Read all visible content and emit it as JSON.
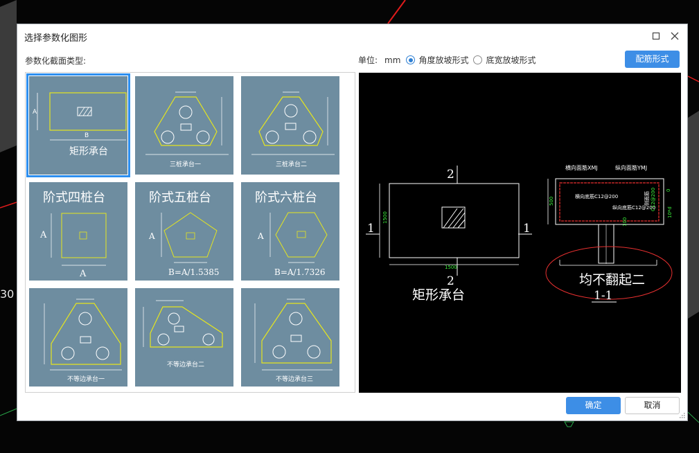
{
  "background": {
    "side_number": "30"
  },
  "window": {
    "title": "选择参数化图形",
    "maximize_icon": "square-icon",
    "close_icon": "close-icon"
  },
  "gallery": {
    "label": "参数化截面类型:",
    "items": [
      {
        "name": "矩形承台",
        "selected": true
      },
      {
        "name": "三桩承台一"
      },
      {
        "name": "三桩承台二"
      },
      {
        "name": "阶式四桩台",
        "formula": "A"
      },
      {
        "name": "阶式五桩台",
        "formula": "B=A/1.5385"
      },
      {
        "name": "阶式六桩台",
        "formula": "B=A/1.7326"
      },
      {
        "name": "不等边承台一"
      },
      {
        "name": "不等边承台二"
      },
      {
        "name": "不等边承台三"
      }
    ]
  },
  "options": {
    "unit_label": "单位:",
    "unit_value": "mm",
    "radio_slope_angle": "角度放坡形式",
    "radio_slope_width": "底宽放坡形式",
    "selected": "angle"
  },
  "buttons": {
    "rebar": "配筋形式",
    "ok": "确定",
    "cancel": "取消"
  },
  "preview": {
    "title": "矩形承台",
    "section_mark": "2",
    "side_mark": "1",
    "dim_width": "1500",
    "dim_height": "1500",
    "section_title": "1-1",
    "section_note": "均不翻起二",
    "depth": "500",
    "labels": {
      "top_x": "横向面筋XMJ",
      "top_y": "纵向面筋YMJ",
      "bot_x": "横向底筋C12@200",
      "bot_y": "纵向底筋C12@200",
      "side": "侧面筋",
      "side_spec": "C12@200",
      "dim_right": "10*d",
      "dim_zero": "0",
      "dim_pile": "100"
    }
  }
}
